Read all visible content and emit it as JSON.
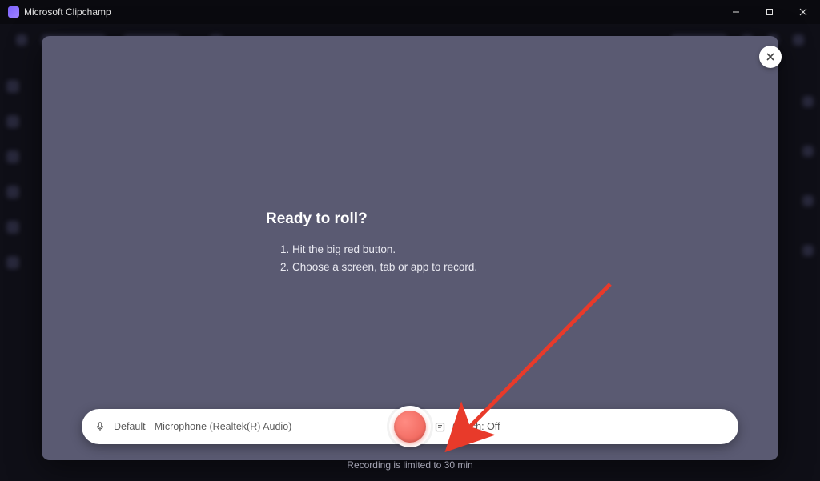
{
  "app": {
    "title": "Microsoft Clipchamp"
  },
  "modal": {
    "title": "Ready to roll?",
    "steps": [
      "1. Hit the big red button.",
      "2. Choose a screen, tab or app to record."
    ]
  },
  "controls": {
    "mic_label": "Default - Microphone (Realtek(R) Audio)",
    "coach_label": "Coach: Off"
  },
  "footer": {
    "limit_text": "Recording is limited to 30 min"
  }
}
